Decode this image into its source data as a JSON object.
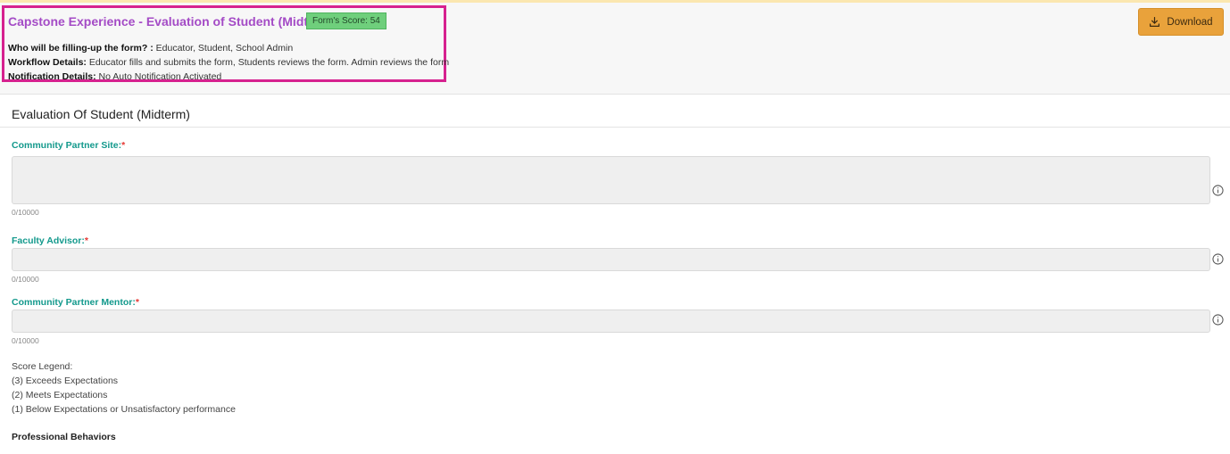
{
  "header": {
    "title": "Capstone Experience - Evaluation of Student (Midterm)",
    "score_badge": "Form's Score: 54",
    "who_label": "Who will be filling-up the form? :",
    "who_value": " Educator, Student, School Admin",
    "workflow_label": "Workflow Details:",
    "workflow_value": " Educator fills and submits the form, Students reviews the form. Admin reviews the form",
    "notification_label": "Notification Details:",
    "notification_value": " No Auto Notification Activated",
    "download_label": "Download"
  },
  "section": {
    "title": "Evaluation Of Student (Midterm)"
  },
  "fields": [
    {
      "label": "Community Partner Site:",
      "required_mark": "*",
      "value": "",
      "counter": "0/10000"
    },
    {
      "label": "Faculty Advisor:",
      "required_mark": "*",
      "value": "",
      "counter": "0/10000"
    },
    {
      "label": "Community Partner Mentor:",
      "required_mark": "*",
      "value": "",
      "counter": "0/10000"
    }
  ],
  "legend": {
    "title": "Score Legend:",
    "items": [
      "(3) Exceeds Expectations",
      "(2) Meets Expectations",
      "(1) Below Expectations or Unsatisfactory performance"
    ]
  },
  "subsection": {
    "title": "Professional Behaviors"
  },
  "icons": {
    "download": "download-icon",
    "info": "info-icon"
  },
  "colors": {
    "title": "#a44bc6",
    "highlight_border": "#d6218f",
    "badge": "#6fcf7c",
    "download_button": "#e9a23b",
    "field_label": "#13998c",
    "required": "#e53935"
  }
}
